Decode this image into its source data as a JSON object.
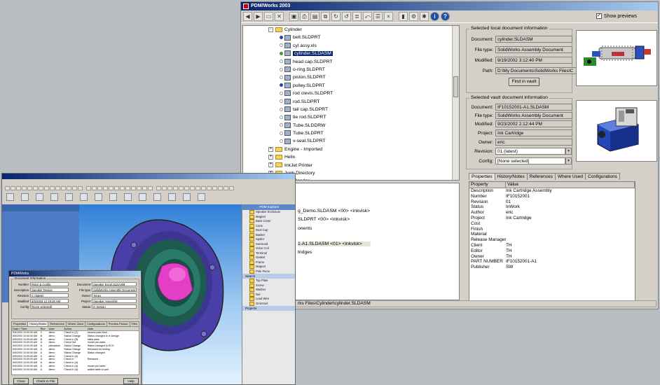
{
  "pdm": {
    "title": "PDM/Works 2003",
    "show_previews_label": "Show previews",
    "show_previews_checked": "✓",
    "tree": [
      {
        "indent": 0,
        "kind": "folder",
        "expander": "-",
        "label": "Cylinder"
      },
      {
        "indent": 1,
        "kind": "part",
        "status": "b",
        "label": "belt.SLDPRT"
      },
      {
        "indent": 1,
        "kind": "doc",
        "status": "w",
        "label": "cyl assy.xls"
      },
      {
        "indent": 1,
        "kind": "part",
        "status": "g",
        "label": "cylinder.SLDASM",
        "selected": true
      },
      {
        "indent": 1,
        "kind": "part",
        "status": "w",
        "label": "head cap.SLDPRT"
      },
      {
        "indent": 1,
        "kind": "part",
        "status": "w",
        "label": "o-ring.SLDPRT"
      },
      {
        "indent": 1,
        "kind": "part",
        "status": "w",
        "label": "piston.SLDPRT"
      },
      {
        "indent": 1,
        "kind": "part",
        "status": "b",
        "label": "pulley.SLDPRT"
      },
      {
        "indent": 1,
        "kind": "part",
        "status": "w",
        "label": "rod clevis.SLDPRT"
      },
      {
        "indent": 1,
        "kind": "part",
        "status": "w",
        "label": "rod.SLDPRT"
      },
      {
        "indent": 1,
        "kind": "part",
        "status": "w",
        "label": "tail cap.SLDPRT"
      },
      {
        "indent": 1,
        "kind": "part",
        "status": "w",
        "label": "tie rod.SLDPRT"
      },
      {
        "indent": 1,
        "kind": "part",
        "status": "w",
        "label": "Tube.SLDDRW"
      },
      {
        "indent": 1,
        "kind": "part",
        "status": "w",
        "label": "Tube.SLDPRT"
      },
      {
        "indent": 1,
        "kind": "part",
        "status": "w",
        "label": "v-seal.SLDPRT"
      },
      {
        "indent": 0,
        "kind": "folder",
        "expander": "+",
        "label": "Engine - Imported"
      },
      {
        "indent": 0,
        "kind": "folder",
        "expander": "+",
        "label": "Helix"
      },
      {
        "indent": 0,
        "kind": "folder",
        "expander": "+",
        "label": "InkJet Printer"
      },
      {
        "indent": 0,
        "kind": "folder",
        "expander": "+",
        "label": "Junk Directory"
      },
      {
        "indent": 0,
        "kind": "folder",
        "expander": "+",
        "label": "PipeBender"
      },
      {
        "indent": 0,
        "kind": "folder",
        "expander": "+",
        "label": "Plastic Part"
      }
    ],
    "lower_lines": [
      "g_Demo.SLDASM <00> <inkvisk>",
      "SLDPRT <00> <inkvisk>",
      "onents",
      "1-A1.SLDASM <01> <inkvisk>",
      "tridges"
    ],
    "status_text": "rks Files\\Cylinder\\cylinder.SLDASM",
    "local": {
      "title": "Selected local document information",
      "document_label": "Document:",
      "document": "cylinder.SLDASM",
      "filetype_label": "File type:",
      "filetype": "SolidWorks Assembly Document",
      "modified_label": "Modified:",
      "modified": "9/19/2002 3:12:40 PM",
      "path_label": "Path:",
      "path": "D:\\My Documents\\SolidWorks Files\\C",
      "find_button": "Find in vault"
    },
    "vault": {
      "title": "Selected vault document information",
      "document_label": "Document:",
      "document": "IF10152001-A1.SLDASM",
      "filetype_label": "File type:",
      "filetype": "SolidWorks Assembly Document",
      "modified_label": "Modified:",
      "modified": "9/23/2002 2:12:44 PM",
      "project_label": "Project:",
      "project": "Ink Cartridge",
      "owner_label": "Owner:",
      "owner": "eric",
      "revision_label": "Revision:",
      "revision": "01 (latest)",
      "config_label": "Config:",
      "config": "[None selected]"
    },
    "tabs": [
      "Properties",
      "History/Notes",
      "References",
      "Where Used",
      "Configurations"
    ],
    "prop_headers": [
      "Property",
      "Value"
    ],
    "properties": [
      [
        "Description",
        "Ink Cartridge Assembly"
      ],
      [
        "Number",
        "IF10152001"
      ],
      [
        "Revision",
        "01"
      ],
      [
        "Status",
        "InWork"
      ],
      [
        "Author",
        "eric"
      ],
      [
        "Project",
        "Ink Cartridge"
      ],
      [
        "Cost",
        ""
      ],
      [
        "Finish",
        ""
      ],
      [
        "Material",
        ""
      ],
      [
        "Release Manager",
        ""
      ],
      [
        "Client",
        "TH"
      ],
      [
        "Editor",
        "TH"
      ],
      [
        "Owner",
        "TH"
      ],
      [
        "PART NUMBER",
        "IF10152001-A1"
      ],
      [
        "Publisher",
        "SW"
      ]
    ]
  },
  "sw": {
    "dialog": {
      "title": "PDMWorks",
      "group_title": "Document Information",
      "number_label": "Number",
      "number": "Rotor & Config",
      "description_label": "Description",
      "description": "Speaker Design",
      "revision_label": "Revision",
      "revision": "C (latest)",
      "modified_label": "Modified",
      "modified": "5/5/2003 12:19:28 AM",
      "config_label": "Config",
      "config": "[None selected]",
      "document_label": "Document",
      "document": "Speaker Excel.SLDASM",
      "filetype_label": "File type",
      "filetype": "SolidWorks Assembly Document",
      "owner_label": "Owner",
      "owner": "Tonex",
      "project_label": "Project",
      "project": "Speaker Assembly",
      "status_label": "Status",
      "status": "In Design",
      "tabs": [
        "Properties",
        "History/Notes",
        "References",
        "Where Used",
        "Configurations",
        "Preview Picture",
        "Files"
      ],
      "history_headers": [
        "Date / Time",
        "Rev",
        "User",
        "Action",
        "Note"
      ],
      "history": [
        [
          "5/5/2003 10:00:00 AM",
          "C",
          "demo",
          "Check In (C)",
          "second pass final..."
        ],
        [
          "5/5/2003 10:00:00 AM",
          "B",
          "demo",
          "Status Change",
          "Status changed to In Design"
        ],
        [
          "5/5/2003 10:00:00 AM",
          "B",
          "demo",
          "Check In (B)",
          "initial pass"
        ],
        [
          "5/5/2003 10:00:00 AM",
          "A",
          "demo",
          "Check Out",
          "model pre-sales"
        ],
        [
          "5/5/2003 10:00:00 AM",
          "A",
          "pdmadmin",
          "Status Change",
          "Status changed to ECO"
        ],
        [
          "5/5/2003 10:00:00 AM",
          "A",
          "demo",
          "Status Change",
          "Released for testing"
        ],
        [
          "5/5/2003 10:00:00 AM",
          "A",
          "demo",
          "Status Change",
          "Status changed"
        ],
        [
          "5/5/2003 10:00:00 AM",
          "A",
          "demo",
          "Check In (A)",
          ""
        ],
        [
          "5/5/2003 10:00:00 AM",
          "A",
          "demo",
          "Check In",
          "Released"
        ],
        [
          "5/5/2003 10:00:00 AM",
          "A",
          "demo",
          "Check In (A)",
          ""
        ],
        [
          "5/5/2003 10:00:00 AM",
          "A",
          "demo",
          "Check In (A)",
          "model pre-sales"
        ],
        [
          "5/5/2003 10:00:00 AM",
          "A",
          "demo",
          "Check In (A)",
          "added table to part"
        ]
      ],
      "buttons": [
        "Close",
        "Check In File",
        "Help"
      ]
    },
    "right_panel_title": "PDM Explorer",
    "right_items": [
      "Speaker Enclosure",
      "Magnet",
      "Back Cover",
      "Cone",
      "Dust Cap",
      "Basket",
      "Spider",
      "Surround",
      "Voice Coil",
      "Terminal",
      "Gasket",
      "Frame",
      "Magnet",
      "Pole Piece",
      "Top Plate",
      "Screw",
      "Washer",
      "Nut",
      "Lead Wire",
      "Grommet"
    ],
    "right_sections": [
      "Search",
      "Projects"
    ]
  }
}
